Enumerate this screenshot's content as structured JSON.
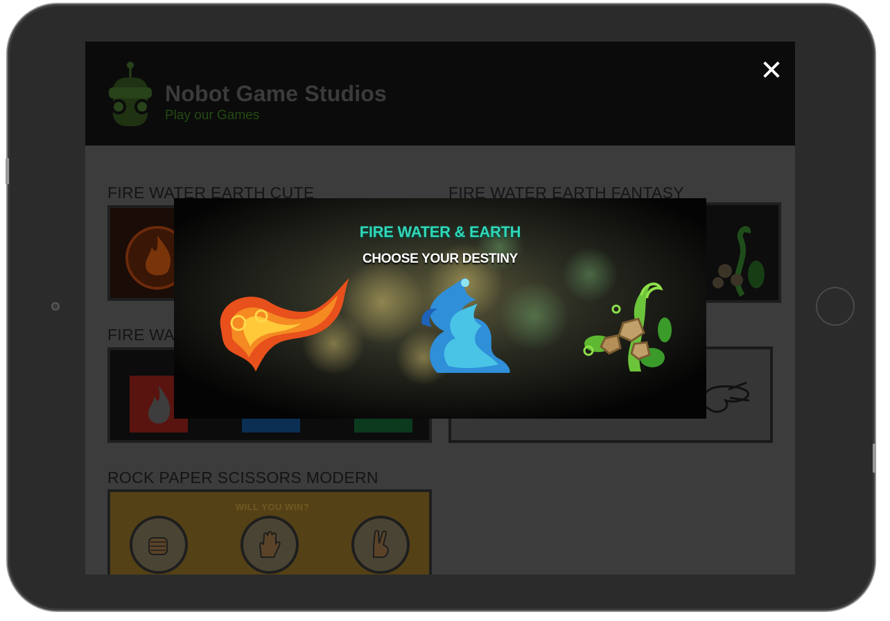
{
  "header": {
    "title": "Nobot Game Studios",
    "subtitle": "Play our Games",
    "close_label": "✕"
  },
  "games": [
    {
      "title": "FIRE WATER EARTH CUTE"
    },
    {
      "title": "FIRE WATER EARTH FANTASY"
    },
    {
      "title": "FIRE WAT"
    },
    {
      "title": "ROCK PAPER SCISSORS MODERN"
    }
  ],
  "rps_tile": {
    "banner": "WILL YOU WIN?"
  },
  "popup": {
    "title": "FIRE WATER & EARTH",
    "subtitle": "CHOOSE YOUR DESTINY",
    "choices": [
      {
        "name": "fire",
        "icon": "fire-swirl-icon"
      },
      {
        "name": "water",
        "icon": "water-wave-icon"
      },
      {
        "name": "earth",
        "icon": "earth-vine-icon"
      }
    ]
  },
  "colors": {
    "popup_title": "#2fd7b8",
    "screen_dim": "#3c3c3c",
    "header_bg": "#0b0b0b"
  }
}
